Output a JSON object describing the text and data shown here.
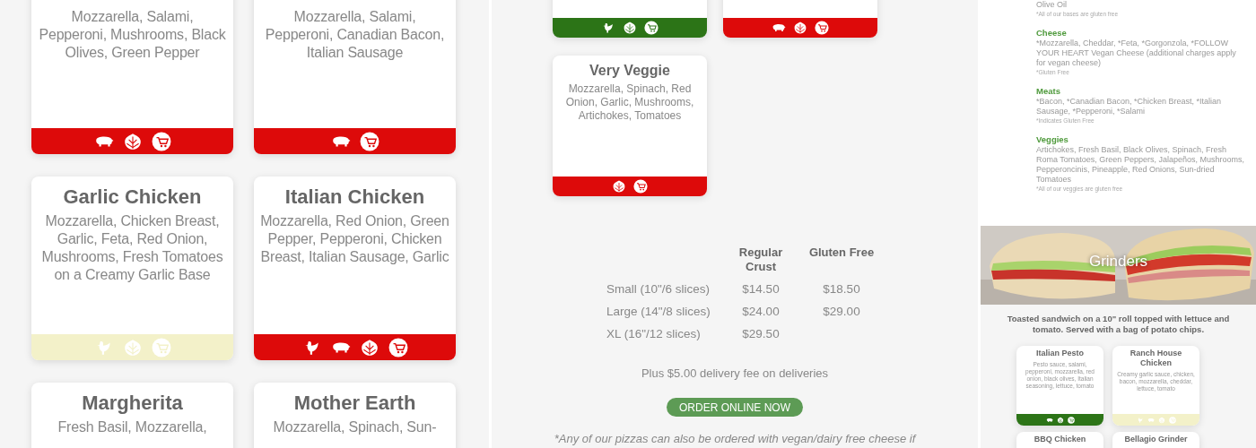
{
  "pizza_cards_left": [
    {
      "description": "Mozzarella, Salami, Pepperoni, Mushrooms, Black Olives, Green Pepper",
      "color": "#dd0a0a",
      "badges": [
        {
          "kind": "pork"
        },
        {
          "kind": "veggie"
        },
        {
          "kind": "cart"
        }
      ]
    },
    {
      "description": "Mozzarella, Salami, Pepperoni, Canadian Bacon, Italian Sausage",
      "color": "#dd0a0a",
      "badges": [
        {
          "kind": "pork"
        },
        {
          "kind": "cart"
        }
      ]
    },
    {
      "title": "Garlic Chicken",
      "description": "Mozzarella, Chicken Breast, Garlic, Feta, Red Onion, Mushrooms, Fresh Tomatoes on a Creamy Garlic Base",
      "color": "#f3f1c9",
      "badges": [
        {
          "kind": "chicken"
        },
        {
          "kind": "veggie"
        },
        {
          "kind": "cart"
        }
      ]
    },
    {
      "title": "Italian Chicken",
      "description": "Mozzarella, Red Onion, Green Pepper, Pepperoni, Chicken Breast, Italian Sausage, Garlic",
      "color": "#dd0a0a",
      "badges": [
        {
          "kind": "chicken"
        },
        {
          "kind": "pork"
        },
        {
          "kind": "veggie"
        },
        {
          "kind": "cart"
        }
      ]
    },
    {
      "title": "Margherita",
      "description": "Fresh Basil, Mozzarella,"
    },
    {
      "title": "Mother Earth",
      "description": "Mozzarella, Spinach, Sun-"
    }
  ],
  "pizza_cards_right": [
    {
      "color": "#2c7417",
      "badges": [
        {
          "kind": "chicken"
        },
        {
          "kind": "veggie"
        },
        {
          "kind": "cart"
        }
      ]
    },
    {
      "color": "#dd0a0a",
      "badges": [
        {
          "kind": "pork"
        },
        {
          "kind": "veggie"
        },
        {
          "kind": "cart"
        }
      ]
    },
    {
      "title": "Very Veggie",
      "description": "Mozzarella, Spinach, Red Onion, Garlic, Mushrooms, Artichokes, Tomatoes",
      "color": "#dd0a0a",
      "badges": [
        {
          "kind": "veggie"
        },
        {
          "kind": "cart"
        }
      ]
    }
  ],
  "price_table": {
    "columns": [
      "Regular Crust",
      "Gluten Free"
    ],
    "rows": [
      {
        "label": "Small (10\"/6 slices)",
        "prices": [
          "$14.50",
          "$18.50"
        ]
      },
      {
        "label": "Large (14\"/8 slices)",
        "prices": [
          "$24.00",
          "$29.00"
        ]
      },
      {
        "label": "XL (16\"/12 slices)",
        "prices": [
          "$29.50"
        ]
      }
    ]
  },
  "delivery_note": "Plus $5.00 delivery fee on deliveries",
  "order_button": "ORDER ONLINE NOW",
  "vegan_note": "*Any of our pizzas can also be ordered with vegan/dairy free cheese if",
  "toppings": [
    {
      "text": "Olive Oil",
      "note": "*All of our bases are gluten free"
    },
    {
      "heading": "Cheese",
      "text": "*Mozzarella, Cheddar, *Feta, *Gorgonzola, *FOLLOW YOUR HEART Vegan Cheese (additional charges apply for vegan cheese)",
      "note": "*Gluten Free"
    },
    {
      "heading": "Meats",
      "text": "*Bacon, *Canadian Bacon, *Chicken Breast, *Italian Sausage, *Pepperoni, *Salami",
      "note": "*Indicates Gluten Free"
    },
    {
      "heading": "Veggies",
      "text": "Artichokes, Fresh Basil, Black Olives, Spinach, Fresh Roma Tomatoes, Green Peppers, Jalapeños, Mushrooms, Pepperoncinis, Pineapple, Red Onions, Sun-dried Tomatoes",
      "note": "*All of our veggies are gluten free"
    }
  ],
  "grinders": {
    "title": "Grinders",
    "description": "Toasted sandwich on a 10\" roll topped with lettuce and tomato. Served with a bag of potato chips.",
    "cards": [
      {
        "title": "Italian Pesto",
        "description": "Pesto sauce, salami, pepperoni, mozzarella, red onion, black olives, Italian seasoning, lettuce, tomato",
        "color": "#2c7417",
        "badges": [
          {
            "kind": "pork"
          },
          {
            "kind": "veggie"
          },
          {
            "kind": "cart"
          }
        ]
      },
      {
        "title": "Ranch House Chicken",
        "description": "Creamy garlic sauce, chicken, bacon, mozzarella, cheddar, lettuce, tomato",
        "color": "#f3f1c9",
        "badges": [
          {
            "kind": "chicken"
          },
          {
            "kind": "pork"
          },
          {
            "kind": "veggie"
          },
          {
            "kind": "cart"
          }
        ]
      },
      {
        "title": "BBQ Chicken"
      },
      {
        "title": "Bellagio Grinder"
      }
    ]
  }
}
